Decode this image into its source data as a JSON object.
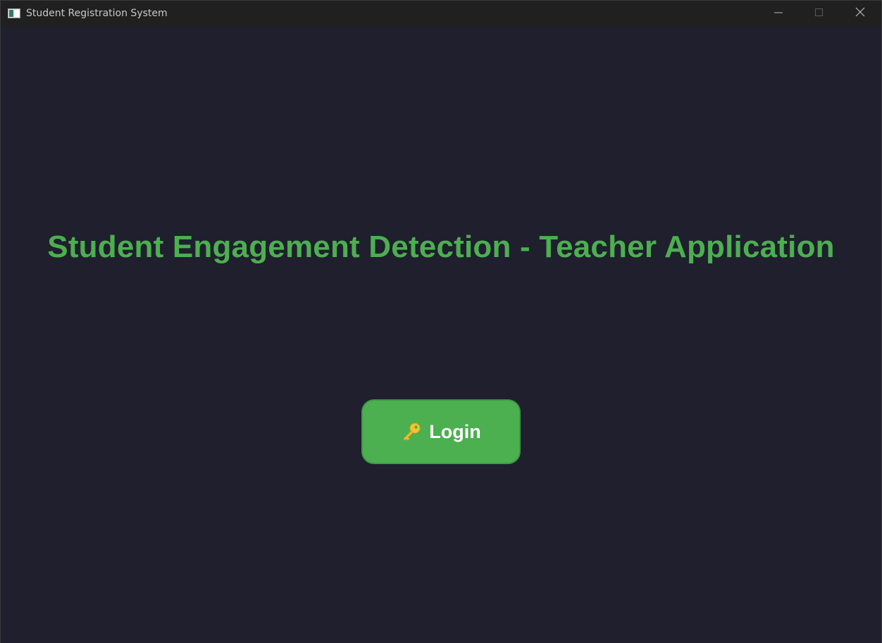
{
  "window": {
    "title": "Student Registration System",
    "app_icon": "window-app-icon"
  },
  "controls": {
    "minimize_icon": "minimize-icon",
    "maximize_icon": "maximize-icon",
    "close_icon": "close-icon"
  },
  "main": {
    "heading": "Student Engagement Detection - Teacher Application",
    "login_button": {
      "icon": "key-icon",
      "label": "Login"
    }
  },
  "colors": {
    "background": "#1f1f2e",
    "titlebar": "#202020",
    "accent": "#4caf50",
    "button_text": "#ffffff"
  }
}
